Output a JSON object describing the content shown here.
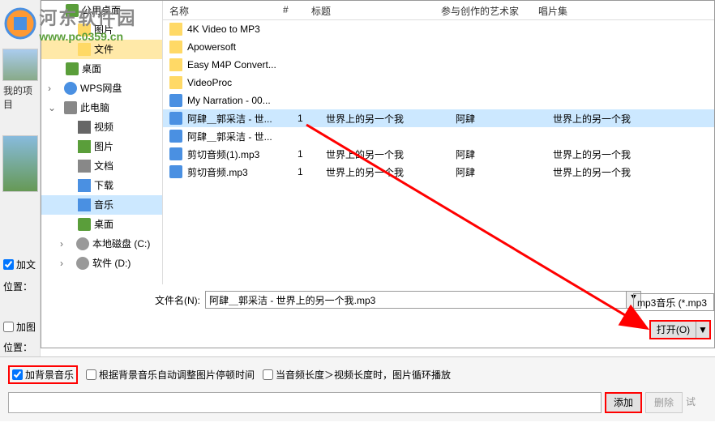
{
  "watermark": {
    "title": "河东软件园",
    "url": "www.pc0359.cn"
  },
  "leftPanel": {
    "projectLabel": "我的项目"
  },
  "tree": {
    "items": [
      {
        "name": "public-desktop",
        "label": "公用桌面",
        "icon": "icon-desktop",
        "indent": 1
      },
      {
        "name": "images",
        "label": "图片",
        "icon": "icon-folder-yellow",
        "indent": 2
      },
      {
        "name": "files",
        "label": "文件",
        "icon": "icon-folder-yellow",
        "indent": 2,
        "selected": false,
        "highlight": true
      },
      {
        "name": "desktop",
        "label": "桌面",
        "icon": "icon-desktop",
        "indent": 1
      },
      {
        "name": "wps",
        "label": "WPS网盘",
        "icon": "icon-cloud",
        "indent": 1,
        "chev": ">"
      },
      {
        "name": "this-pc",
        "label": "此电脑",
        "icon": "icon-computer",
        "indent": 1,
        "chev": "v"
      },
      {
        "name": "videos",
        "label": "视频",
        "icon": "icon-video",
        "indent": 2
      },
      {
        "name": "pictures",
        "label": "图片",
        "icon": "icon-image",
        "indent": 2
      },
      {
        "name": "documents",
        "label": "文档",
        "icon": "icon-doc",
        "indent": 2
      },
      {
        "name": "downloads",
        "label": "下载",
        "icon": "icon-download",
        "indent": 2
      },
      {
        "name": "music",
        "label": "音乐",
        "icon": "icon-music",
        "indent": 2,
        "selected": true
      },
      {
        "name": "desktop2",
        "label": "桌面",
        "icon": "icon-desktop",
        "indent": 2
      },
      {
        "name": "disk-c",
        "label": "本地磁盘 (C:)",
        "icon": "icon-disk",
        "indent": 2,
        "chev": ">"
      },
      {
        "name": "disk-d",
        "label": "软件 (D:)",
        "icon": "icon-disk",
        "indent": 2,
        "chev": ">"
      }
    ]
  },
  "listHeader": {
    "name": "名称",
    "num": "#",
    "title": "标题",
    "artist": "参与创作的艺术家",
    "album": "唱片集"
  },
  "files": [
    {
      "type": "folder",
      "name": "4K Video to MP3"
    },
    {
      "type": "folder",
      "name": "Apowersoft"
    },
    {
      "type": "folder",
      "name": "Easy M4P Convert..."
    },
    {
      "type": "folder",
      "name": "VideoProc"
    },
    {
      "type": "audio",
      "name": "My Narration - 00..."
    },
    {
      "type": "audio",
      "name": "阿肆＿郭采洁 - 世...",
      "num": "1",
      "title": "世界上的另一个我",
      "artist": "阿肆",
      "album": "世界上的另一个我",
      "selected": true
    },
    {
      "type": "audio",
      "name": "阿肆＿郭采洁 - 世..."
    },
    {
      "type": "audio",
      "name": "剪切音频(1).mp3",
      "num": "1",
      "title": "世界上的另一个我",
      "artist": "阿肆",
      "album": "世界上的另一个我"
    },
    {
      "type": "audio",
      "name": "剪切音频.mp3",
      "num": "1",
      "title": "世界上的另一个我",
      "artist": "阿肆",
      "album": "世界上的另一个我"
    }
  ],
  "filename": {
    "label": "文件名(N):",
    "value": "阿肆＿郭采洁 - 世界上的另一个我.mp3",
    "filter": "mp3音乐 (*.mp3"
  },
  "openBtn": {
    "label": "打开(O)",
    "dd": "▼"
  },
  "sidebar": {
    "addText": "加文",
    "position": "位置：",
    "addImage": "加图",
    "position2": "位置："
  },
  "bottom": {
    "addBgMusic": "加背景音乐",
    "autoAdjust": "根据背景音乐自动调整图片停顿时间",
    "loop": "当音频长度＞视频长度时，图片循环播放",
    "addBtn": "添加",
    "delBtn": "删除",
    "tryBtn": "试"
  }
}
